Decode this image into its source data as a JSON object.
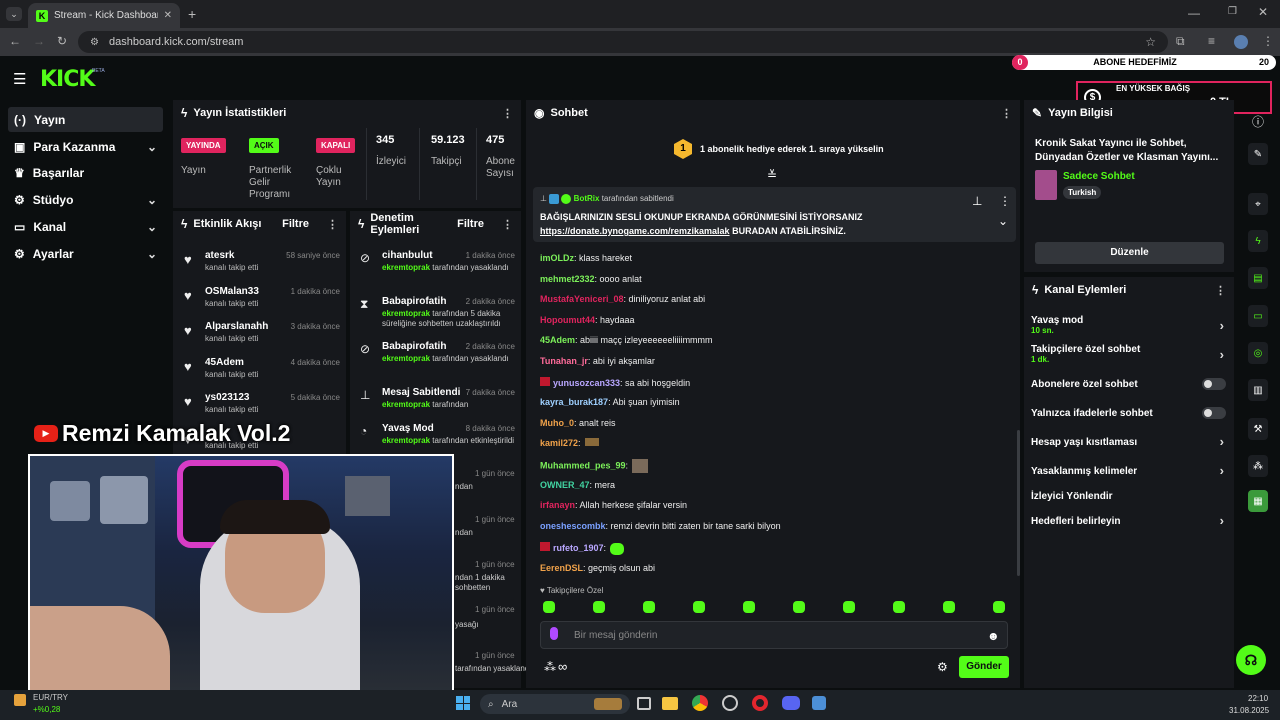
{
  "browser": {
    "tab_title": "Stream - Kick Dashboard",
    "url": "dashboard.kick.com/stream"
  },
  "header": {
    "logo": "KICK",
    "beta": "BETA",
    "goal_count_left": "0",
    "goal_label": "ABONE HEDEFİMİZ",
    "goal_count_right": "20",
    "donation_title": "EN YÜKSEK BAĞIŞ",
    "donation_name": "-",
    "donation_amount": "0 TL"
  },
  "sidebar": {
    "items": [
      {
        "label": "Yayın",
        "icon": "broadcast-icon"
      },
      {
        "label": "Para Kazanma",
        "icon": "money-icon"
      },
      {
        "label": "Başarılar",
        "icon": "trophy-icon"
      },
      {
        "label": "Stüdyo",
        "icon": "studio-icon"
      },
      {
        "label": "Kanal",
        "icon": "channel-icon"
      },
      {
        "label": "Ayarlar",
        "icon": "gear-icon"
      }
    ]
  },
  "stats": {
    "title": "Yayın İstatistikleri",
    "live_badge": "YAYINDA",
    "live_label": "Yayın",
    "partner_badge": "AÇIK",
    "partner_label": "Partnerlik Gelir Programı",
    "multi_badge": "KAPALI",
    "multi_label": "Çoklu Yayın",
    "viewers_value": "345",
    "viewers_label": "İzleyici",
    "followers_value": "59.123",
    "followers_label": "Takipçi",
    "subs_value": "475",
    "subs_label": "Abone Sayısı"
  },
  "activity": {
    "title": "Etkinlik Akışı",
    "filter": "Filtre",
    "events": [
      {
        "name": "atesrk",
        "desc": "kanalı takip etti",
        "time": "58 saniye önce"
      },
      {
        "name": "OSMalan33",
        "desc": "kanalı takip etti",
        "time": "1 dakika önce"
      },
      {
        "name": "Alparslanahh",
        "desc": "kanalı takip etti",
        "time": "3 dakika önce"
      },
      {
        "name": "45Adem",
        "desc": "kanalı takip etti",
        "time": "4 dakika önce"
      },
      {
        "name": "ys023123",
        "desc": "kanalı takip etti",
        "time": "5 dakika önce"
      },
      {
        "name": "",
        "desc": "kanalı takip etti",
        "time": ""
      }
    ]
  },
  "moderation": {
    "title": "Denetim Eylemleri",
    "filter": "Filtre",
    "actions": [
      {
        "name": "cihanbulut",
        "mod": "ekremtoprak",
        "desc": "tarafından yasaklandı",
        "time": "1 dakika önce"
      },
      {
        "name": "Babapirofatih",
        "mod": "ekremtoprak",
        "desc": "tarafından 5 dakika süreliğine sohbetten uzaklaştırıldı",
        "time": "2 dakika önce"
      },
      {
        "name": "Babapirofatih",
        "mod": "ekremtoprak",
        "desc": "tarafından yasaklandı",
        "time": "2 dakika önce"
      },
      {
        "name": "Mesaj Sabitlendi",
        "mod": "ekremtoprak",
        "desc": "tarafından",
        "time": "7 dakika önce"
      },
      {
        "name": "Yavaş Mod",
        "mod": "ekremtoprak",
        "desc": "tarafından etkinleştirildi",
        "time": "8 dakika önce"
      }
    ],
    "partial": [
      {
        "time": "1 gün önce",
        "desc": "ndan"
      },
      {
        "time": "1 gün önce",
        "desc": "ndan"
      },
      {
        "time": "1 gün önce",
        "desc": "ndan 1 dakika sohbetten"
      },
      {
        "time": "1 gün önce",
        "desc": "yasağı"
      },
      {
        "time": "1 gün önce",
        "desc": "tarafından yasaklandı"
      }
    ]
  },
  "chat": {
    "title": "Sohbet",
    "gift_badge": "1",
    "gift_text": "1 abonelik hediye ederek 1. sıraya yükselin",
    "pinned_user": "BotRix",
    "pinned_by": "tarafından sabitlendi",
    "pinned_line1": "BAĞIŞLARINIZIN SESLİ OKUNUP EKRANDA GÖRÜNMESİNİ İSTİYORSANIZ",
    "pinned_link": "https://donate.bynogame.com/remzikamalak",
    "pinned_line2": "BURADAN ATABİLİRSİNİZ.",
    "messages": [
      {
        "user": "imOLDz",
        "color": "#7cf05a",
        "text": ": klass hareket"
      },
      {
        "user": "mehmet2332",
        "color": "#7cf05a",
        "text": ": oooo anlat"
      },
      {
        "user": "MustafaYeniceri_08",
        "color": "#e0245e",
        "text": ": diniliyoruz anlat abi"
      },
      {
        "user": "Hopoumut44",
        "color": "#e0245e",
        "text": ": haydaaa"
      },
      {
        "user": "45Adem",
        "color": "#7cf05a",
        "text": ": abiiii maçç izleyeeeeeeliiiimmmm"
      },
      {
        "user": "Tunahan_jr",
        "color": "#ff6b9a",
        "text": ": abi iyi akşamlar"
      },
      {
        "user": "yunusozcan333",
        "color": "#b9a7ff",
        "text": ": sa abi hoşgeldin"
      },
      {
        "user": "kayra_burak187",
        "color": "#9fd0ff",
        "text": ": Abi şuan iyimisin"
      },
      {
        "user": "Muho_0",
        "color": "#f0a24a",
        "text": ": analt reis"
      },
      {
        "user": "kamil272",
        "color": "#f0a24a",
        "text": ":"
      },
      {
        "user": "Muhammed_pes_99",
        "color": "#7cf05a",
        "text": ":"
      },
      {
        "user": "OWNER_47",
        "color": "#41d3a1",
        "text": ": mera"
      },
      {
        "user": "irfanayn",
        "color": "#e0245e",
        "text": ": Allah herkese şifalar versin"
      },
      {
        "user": "oneshescombk",
        "color": "#7aa0ff",
        "text": ": remzi devrin bitti zaten bir tane sarki bilyon"
      },
      {
        "user": "rufeto_1907",
        "color": "#b9a7ff",
        "text": ":"
      },
      {
        "user": "EerenDSL",
        "color": "#f0a24a",
        "text": ": geçmiş olsun abi"
      }
    ],
    "followers_only": "Takipçilere Özel",
    "input_placeholder": "Bir mesaj gönderin",
    "send_button": "Gönder",
    "infinity": "∞"
  },
  "stream_info": {
    "title": "Yayın Bilgisi",
    "stream_title": "Kronik Sakat Yayıncı ile Sohbet, Dünyadan Özetler ve Klasman Yayını...",
    "category": "Sadece Sohbet",
    "language": "Turkish",
    "edit_button": "Düzenle"
  },
  "channel_actions": {
    "title": "Kanal Eylemleri",
    "items": [
      {
        "label": "Yavaş mod",
        "sub": "10 sn.",
        "type": "arrow"
      },
      {
        "label": "Takipçilere özel sohbet",
        "sub": "1 dk.",
        "type": "arrow"
      },
      {
        "label": "Abonelere özel sohbet",
        "sub": "",
        "type": "toggle"
      },
      {
        "label": "Yalnızca ifadelerle sohbet",
        "sub": "",
        "type": "toggle"
      },
      {
        "label": "Hesap yaşı kısıtlaması",
        "sub": "",
        "type": "arrow"
      },
      {
        "label": "Yasaklanmış kelimeler",
        "sub": "",
        "type": "arrow"
      },
      {
        "label": "İzleyici Yönlendir",
        "sub": "",
        "type": "none"
      },
      {
        "label": "Hedefleri belirleyin",
        "sub": "",
        "type": "arrow"
      }
    ]
  },
  "overlay": {
    "channel_name": "Remzi Kamalak Vol.2"
  },
  "taskbar": {
    "search": "Ara",
    "ticker_pair": "EUR/TRY",
    "ticker_change": "+%0,28",
    "time": "22:10",
    "date": "31.08.2025"
  },
  "colors": {
    "accent": "#53fc18",
    "live": "#e0245e",
    "panel": "#16181c"
  }
}
